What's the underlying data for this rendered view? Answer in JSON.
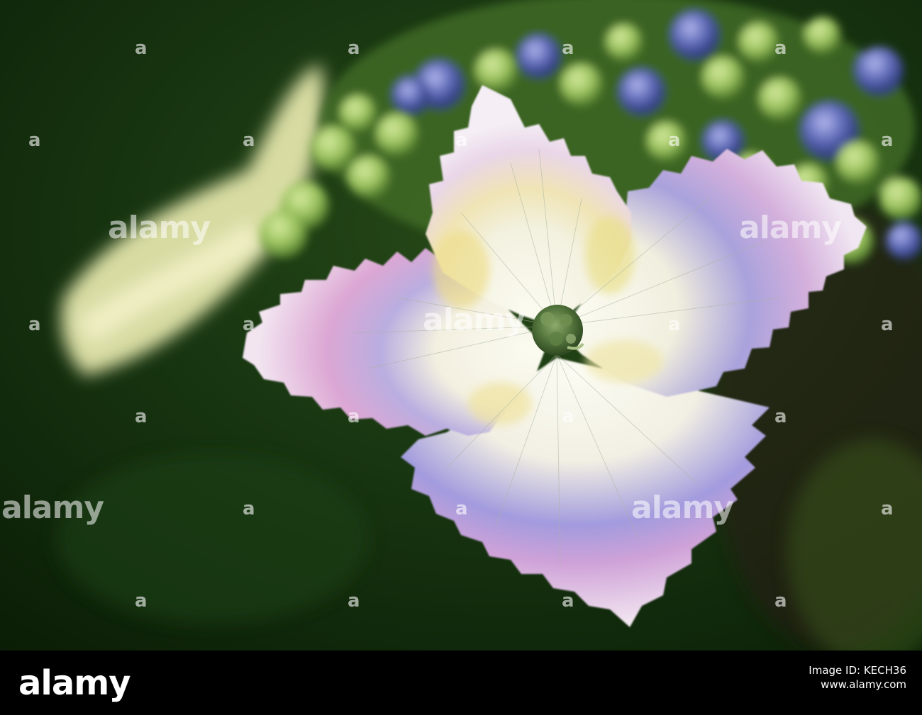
{
  "scene": {
    "subject": "hydrangea-flower",
    "colors": {
      "background": "#0f2509",
      "petal_white": "#f4f0e6",
      "petal_pink": "#e0a6d2",
      "petal_blue": "#9e95db",
      "petal_yellow": "#efe7a2",
      "bud_green": "#8fbb57",
      "bud_blue": "#5d6cb4",
      "center_green": "#4a6a35"
    }
  },
  "watermark": {
    "text": "alamy",
    "dot": "a"
  },
  "footer": {
    "logo": "alamy",
    "image_id_label": "Image ID: KECH36",
    "image_id": "KECH36",
    "url": "www.alamy.com"
  }
}
